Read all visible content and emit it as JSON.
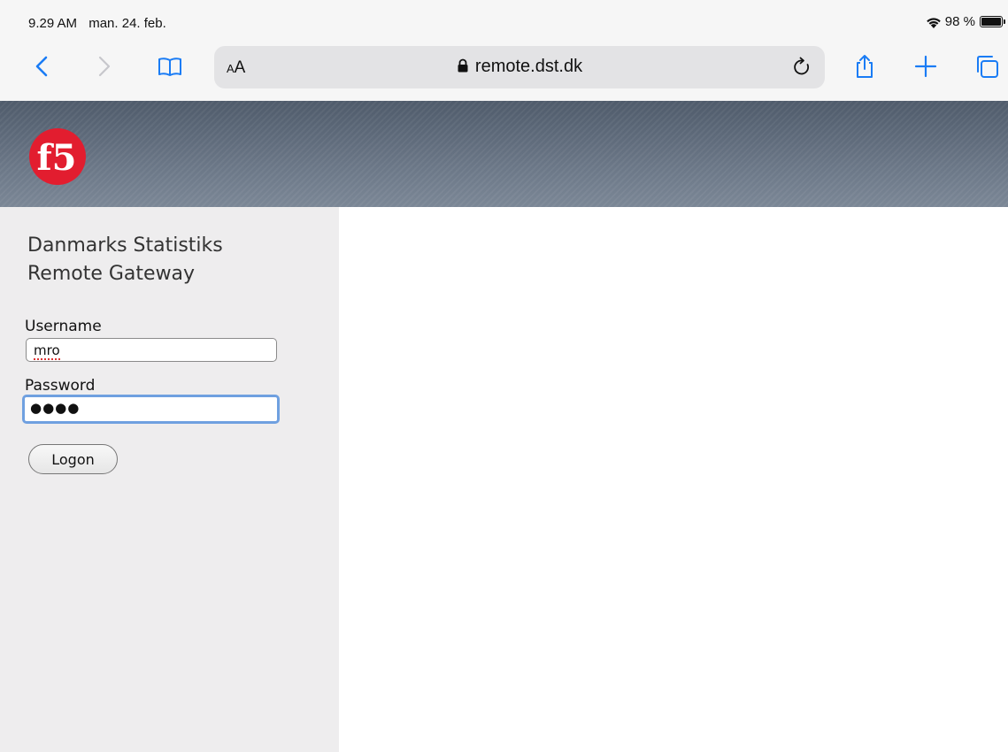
{
  "status_bar": {
    "time": "9.29 AM",
    "date": "man. 24. feb.",
    "battery_percent": "98 %"
  },
  "browser": {
    "text_size_label_small": "A",
    "text_size_label_large": "A",
    "url": "remote.dst.dk",
    "icons": [
      "back-icon",
      "forward-icon",
      "bookmarks-icon",
      "lock-icon",
      "reload-icon",
      "share-icon",
      "new-tab-icon",
      "tabs-icon"
    ]
  },
  "page": {
    "logo_text": "f5",
    "title_line1": "Danmarks Statistiks",
    "title_line2": "Remote Gateway",
    "username_label": "Username",
    "username_value": "mro",
    "password_label": "Password",
    "password_mask": "●●●●",
    "logon_label": "Logon"
  },
  "colors": {
    "banner": "#5f6b7b",
    "sidebar": "#eeedee",
    "logo_red": "#e21d2f",
    "focus_ring": "#6fa0e0",
    "ios_blue": "#1a7cf5"
  }
}
